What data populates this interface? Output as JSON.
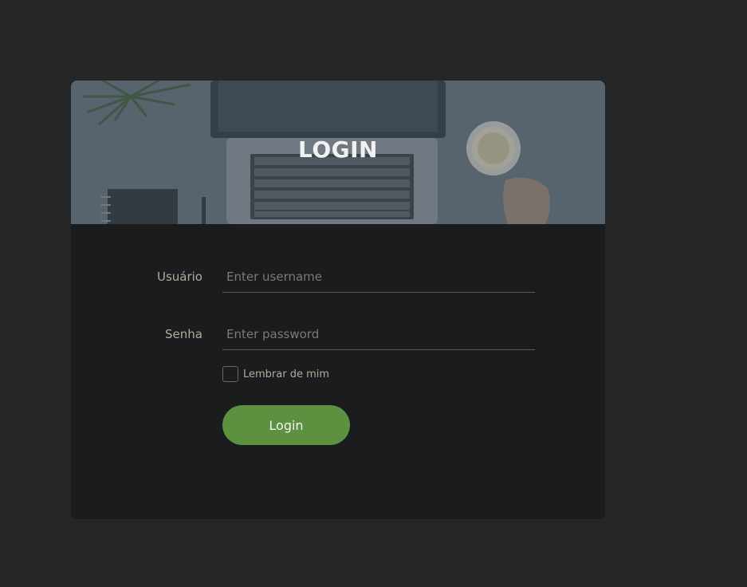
{
  "banner": {
    "title": "LOGIN"
  },
  "form": {
    "username": {
      "label": "Usuário",
      "placeholder": "Enter username",
      "value": ""
    },
    "password": {
      "label": "Senha",
      "placeholder": "Enter password",
      "value": ""
    },
    "remember": {
      "label": "Lembrar de mim",
      "checked": false
    },
    "submit_label": "Login"
  },
  "colors": {
    "page_background": "#252627",
    "card_background": "#1b1c1d",
    "accent_button": "#5c9140",
    "label_text": "#b3ab9c"
  }
}
